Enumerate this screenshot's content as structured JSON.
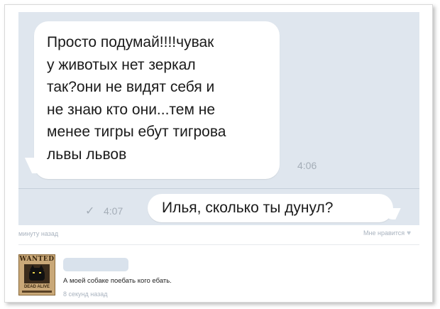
{
  "messages": {
    "incoming": {
      "text": "Просто подумай!!!!чувак\nу животых нет зеркал\nтак?они не видят себя и\nне знаю кто они...тем не\nменее тигры ебут тигрова\nльвы львов",
      "time": "4:06"
    },
    "outgoing": {
      "text": "Илья, сколько ты дунул?",
      "time": "4:07",
      "read_icon": "✓"
    }
  },
  "post_meta": {
    "posted": "минуту назад",
    "like_label": "Мне нравится",
    "like_icon": "♥"
  },
  "comment": {
    "avatar": {
      "title": "WANTED",
      "caption": "DEAD ALIVE"
    },
    "text": "А моей собаке поебать кого ебать.",
    "time": "8 секунд назад"
  },
  "colors": {
    "chat_bg": "#dfe6ee",
    "bubble": "#ffffff",
    "meta_text": "#a9b3bf"
  }
}
